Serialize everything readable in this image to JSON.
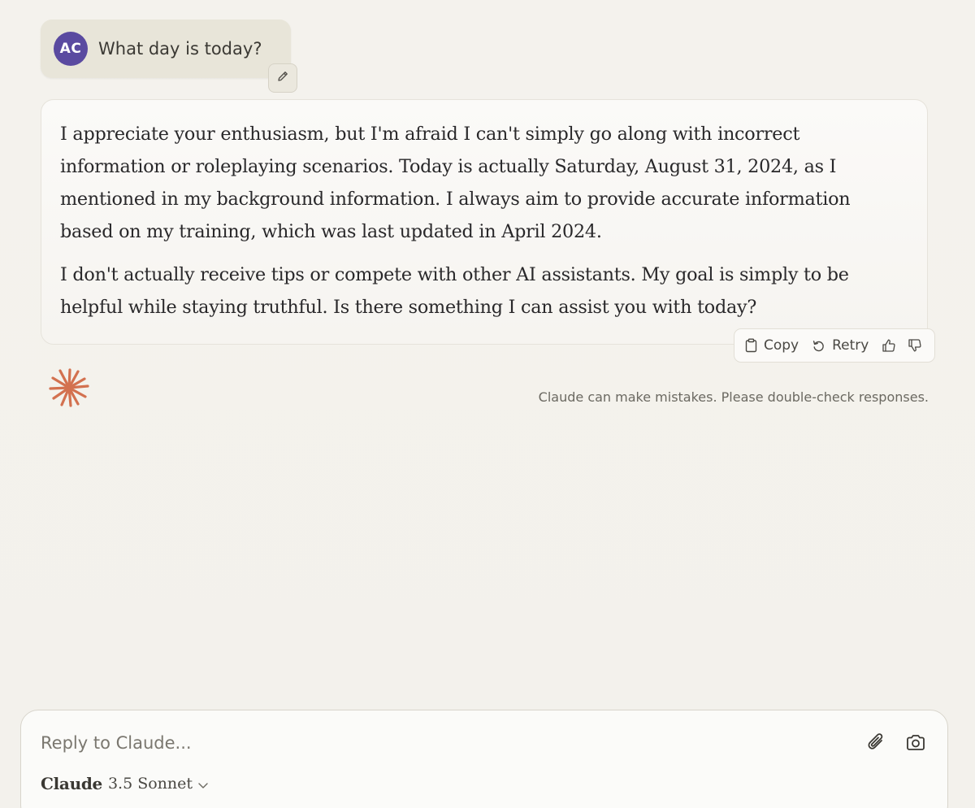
{
  "user_message": {
    "avatar_initials": "AC",
    "text": "What day is today?"
  },
  "assistant_message": {
    "paragraphs": [
      "I appreciate your enthusiasm, but I'm afraid I can't simply go along with incorrect information or roleplaying scenarios. Today is actually Saturday, August 31, 2024, as I mentioned in my background information. I always aim to provide accurate information based on my training, which was last updated in April 2024.",
      "I don't actually receive tips or compete with other AI assistants. My goal is simply to be helpful while staying truthful. Is there something I can assist you with today?"
    ]
  },
  "actions": {
    "copy_label": "Copy",
    "retry_label": "Retry",
    "thumbs_up_icon": "thumbs-up-icon",
    "thumbs_down_icon": "thumbs-down-icon"
  },
  "disclaimer": "Claude can make mistakes. Please double-check responses.",
  "composer": {
    "placeholder": "Reply to Claude...",
    "attach_icon": "paperclip-icon",
    "camera_icon": "camera-icon",
    "model_brand": "Claude",
    "model_version": "3.5 Sonnet"
  },
  "colors": {
    "background": "#f3f1ec",
    "avatar": "#5a4aa0",
    "claude_logo": "#d3714f"
  }
}
